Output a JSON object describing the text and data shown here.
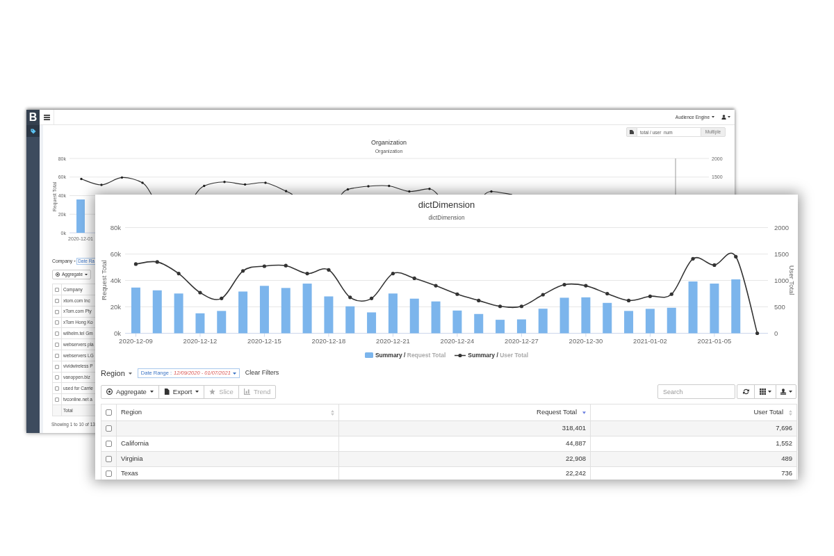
{
  "back_window": {
    "sidebar": {
      "logo": "B",
      "items": [
        {
          "selected": true
        }
      ]
    },
    "top_bar": {
      "engine_menu": "Audience Engine"
    },
    "metric_picker": {
      "value": "total / user_num",
      "button": "Multiple"
    },
    "chart": {
      "title": "Organization",
      "subtitle": "Organization",
      "ylabel": "Request Total",
      "yticks": [
        "80k",
        "60k",
        "40k",
        "20k",
        "0k"
      ],
      "y2ticks": [
        "2000",
        "1500"
      ],
      "xticks": [
        "2020-12-01"
      ]
    },
    "filter": {
      "dimension": "Company",
      "tag": "Date Ra"
    },
    "toolbar": {
      "aggregate": "Aggregate"
    },
    "table": {
      "header_checked": false,
      "column": "Company",
      "rows": [
        {
          "checked": false,
          "company": "xtom.com Inc"
        },
        {
          "checked": false,
          "company": "xTom.com Pty"
        },
        {
          "checked": false,
          "company": "xTom Hong Ko"
        },
        {
          "checked": false,
          "company": "wilhelm.tel Gm"
        },
        {
          "checked": false,
          "company": "webservers pla"
        },
        {
          "checked": false,
          "company": "webservers LG"
        },
        {
          "checked": false,
          "company": "vividwireless P"
        },
        {
          "checked": false,
          "company": "vanoppen.biz"
        },
        {
          "checked": false,
          "company": "used for Carrie"
        },
        {
          "checked": false,
          "company": "tvconline.net a"
        }
      ],
      "total": "Total"
    },
    "footer": "Showing 1 to 10 of 13"
  },
  "front_window": {
    "chart": {
      "subtitle": "dictDimension",
      "chart_data": {
        "type": "bar",
        "title": "dictDimension",
        "ylabel": "Request Total",
        "y2label": "User Total",
        "grid": true,
        "legend": "bottom",
        "ylim": [
          0,
          80000
        ],
        "y2lim": [
          0,
          2000
        ],
        "yticks": [
          {
            "value": 0,
            "label": "0k"
          },
          {
            "value": 20000,
            "label": "20k"
          },
          {
            "value": 40000,
            "label": "40k"
          },
          {
            "value": 60000,
            "label": "60k"
          },
          {
            "value": 80000,
            "label": "80k"
          }
        ],
        "y2ticks": [
          {
            "value": 0,
            "label": "0"
          },
          {
            "value": 500,
            "label": "500"
          },
          {
            "value": 1000,
            "label": "1000"
          },
          {
            "value": 1500,
            "label": "1500"
          },
          {
            "value": 2000,
            "label": "2000"
          }
        ],
        "categories": [
          "2020-12-09",
          null,
          null,
          "2020-12-12",
          null,
          null,
          "2020-12-15",
          null,
          null,
          "2020-12-18",
          null,
          null,
          "2020-12-21",
          null,
          null,
          "2020-12-24",
          null,
          null,
          "2020-12-27",
          null,
          null,
          "2020-12-30",
          null,
          null,
          "2021-01-02",
          null,
          null,
          "2021-01-05",
          null,
          null
        ],
        "series": [
          {
            "name": "**Summary /** Request Total",
            "color": "#7cb5ec",
            "values": [
              34600,
              32500,
              30100,
              15100,
              16900,
              31600,
              35900,
              34300,
              37600,
              27900,
              20400,
              15800,
              30100,
              26200,
              24100,
              17200,
              14600,
              10200,
              10500,
              18600,
              26900,
              27200,
              23000,
              16900,
              18500,
              19300,
              39200,
              37600,
              40800,
              null
            ]
          },
          {
            "name": "**Summary /** User Total",
            "type": "line",
            "axis": "y2",
            "color": "#333333",
            "values": [
              1310,
              1350,
              1130,
              770,
              660,
              1180,
              1270,
              1280,
              1130,
              1200,
              680,
              660,
              1130,
              1040,
              900,
              740,
              620,
              510,
              510,
              730,
              920,
              900,
              750,
              620,
              700,
              740,
              1410,
              1290,
              1450,
              0
            ]
          }
        ]
      }
    },
    "filter": {
      "dimension": "Region",
      "date_range": {
        "label": "Date Range :",
        "value": "12/09/2020 - 01/07/2021"
      },
      "clear": "Clear Filters"
    },
    "toolbar": {
      "buttons": [
        {
          "kind": "aggregate",
          "label": "Aggregate",
          "dropdown": true,
          "disabled": false
        },
        {
          "kind": "export",
          "label": "Export",
          "dropdown": true,
          "disabled": false
        },
        {
          "kind": "slice",
          "label": "Slice",
          "dropdown": false,
          "disabled": true
        },
        {
          "kind": "trend",
          "label": "Trend",
          "dropdown": false,
          "disabled": true
        }
      ],
      "search": {
        "placeholder": "Search"
      },
      "tools": [
        {
          "kind": "refresh",
          "dropdown": false
        },
        {
          "kind": "columns",
          "dropdown": true
        },
        {
          "kind": "export",
          "dropdown": true
        }
      ]
    },
    "table": {
      "header_checked": false,
      "columns": [
        {
          "label": "Region",
          "kind": "text",
          "sort_asc": false,
          "sort_desc": false
        },
        {
          "label": "Request Total",
          "kind": "number",
          "sort_asc": false,
          "sort_desc": true
        },
        {
          "label": "User Total",
          "kind": "number",
          "sort_asc": false,
          "sort_desc": false
        }
      ],
      "rows": [
        {
          "checked": false,
          "request_total": "318,401",
          "user_total": "7,696"
        },
        {
          "checked": false,
          "region": "California",
          "request_total": "44,887",
          "user_total": "1,552"
        },
        {
          "checked": false,
          "region": "Virginia",
          "request_total": "22,908",
          "user_total": "489"
        },
        {
          "checked": false,
          "region": "Texas",
          "request_total": "22,242",
          "user_total": "736"
        }
      ]
    }
  }
}
